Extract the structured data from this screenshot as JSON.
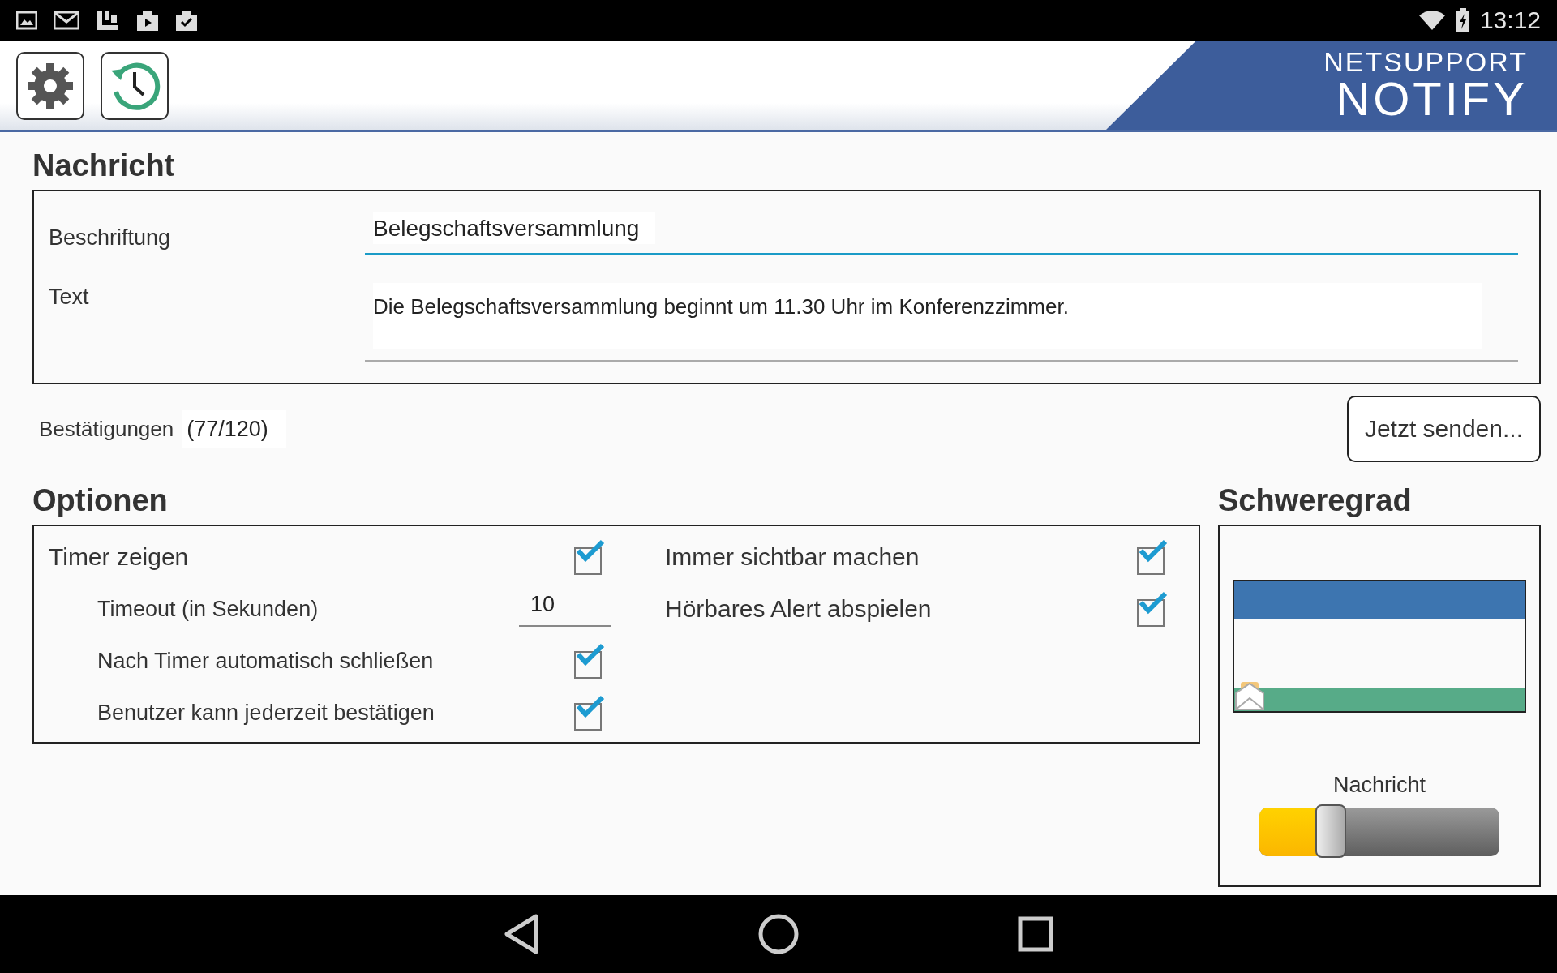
{
  "status_bar": {
    "time": "13:12"
  },
  "header": {
    "logo_top": "NETSUPPORT",
    "logo_bottom": "NOTIFY"
  },
  "message": {
    "heading": "Nachricht",
    "caption_label": "Beschriftung",
    "caption_value": "Belegschaftsversammlung",
    "text_label": "Text",
    "text_value": "Die Belegschaftsversammlung beginnt um 11.30 Uhr im Konferenzzimmer."
  },
  "confirmations": {
    "label": "Bestätigungen",
    "count": "(77/120)"
  },
  "send_button": "Jetzt senden...",
  "options": {
    "heading": "Optionen",
    "left": [
      {
        "kind": "checkbox",
        "label": "Timer zeigen",
        "checked": true,
        "children": [
          {
            "kind": "number",
            "label": "Timeout (in Sekunden)",
            "value": "10"
          },
          {
            "kind": "checkbox",
            "label": "Nach Timer automatisch schließen",
            "checked": true
          },
          {
            "kind": "checkbox",
            "label": "Benutzer kann jederzeit bestätigen",
            "checked": true
          }
        ]
      }
    ],
    "right": [
      {
        "kind": "checkbox",
        "label": "Immer sichtbar machen",
        "checked": true
      },
      {
        "kind": "checkbox",
        "label": "Hörbares Alert abspielen",
        "checked": true
      }
    ]
  },
  "severity": {
    "heading": "Schweregrad",
    "level_label": "Nachricht",
    "level": 0.3
  }
}
